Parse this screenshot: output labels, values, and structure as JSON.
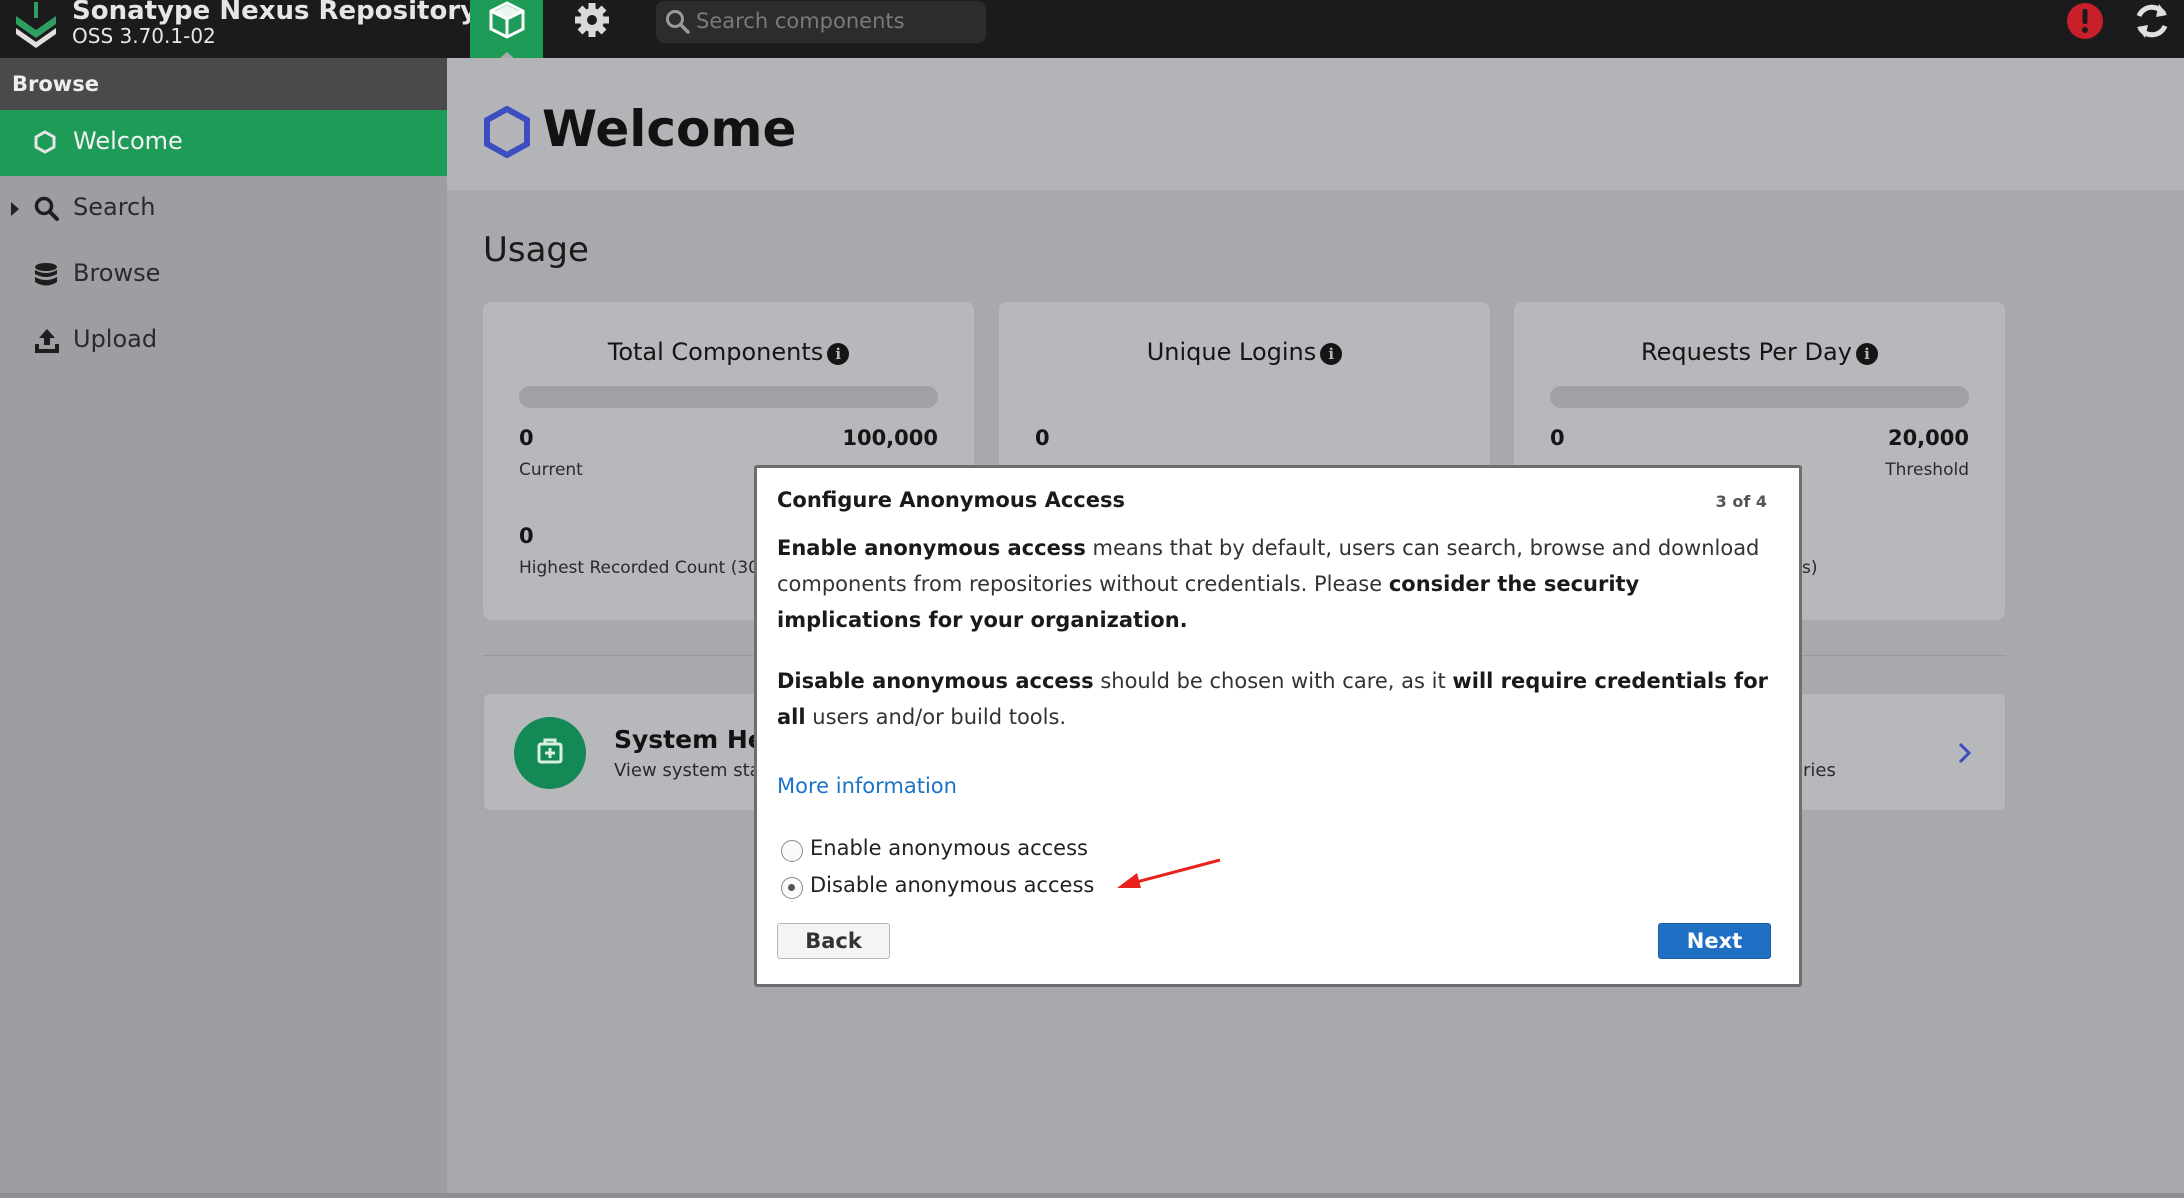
{
  "header": {
    "title": "Sonatype Nexus Repository",
    "version": "OSS 3.70.1-02",
    "search_placeholder": "Search components",
    "nav": [
      "browse-cube-icon",
      "gear-icon"
    ],
    "accent_color": "#1f9b58"
  },
  "sidebar": {
    "header": "Browse",
    "items": [
      {
        "label": "Welcome",
        "icon": "hexagon-icon",
        "active": true
      },
      {
        "label": "Search",
        "icon": "magnifier-icon",
        "active": false
      },
      {
        "label": "Browse",
        "icon": "database-icon",
        "active": false
      },
      {
        "label": "Upload",
        "icon": "upload-icon",
        "active": false
      }
    ]
  },
  "main": {
    "title": "Welcome",
    "usage_title": "Usage",
    "cards": [
      {
        "title": "Total Components",
        "left_value": "0",
        "right_value": "100,000",
        "left_sub": "Current",
        "low_value": "0",
        "low_sub": "Highest Recorded Count (30 d"
      },
      {
        "title": "Unique Logins",
        "left_value": "0"
      },
      {
        "title": "Requests Per Day",
        "left_value": "0",
        "right_value": "20,000",
        "right_sub": "Threshold",
        "low_sub_frag": "ys)"
      }
    ],
    "health": {
      "title": "System Hea",
      "desc": "View system stat",
      "right_frag": "ories"
    }
  },
  "modal": {
    "title": "Configure Anonymous Access",
    "step": "3 of 4",
    "p1": {
      "b1": "Enable anonymous access",
      "t1": " means that by default, users can search, browse and download components from repositories without credentials. Please ",
      "b2": "consider the security implications for your organization."
    },
    "p2": {
      "b1": "Disable anonymous access",
      "t1": " should be chosen with care, as it ",
      "b2": "will require credentials for all",
      "t2": " users and/or build tools."
    },
    "more_link": "More information",
    "options": [
      "Enable anonymous access",
      "Disable anonymous access"
    ],
    "selected_option": "Disable anonymous access",
    "back_label": "Back",
    "next_label": "Next",
    "next_color": "#1f6fc5"
  }
}
